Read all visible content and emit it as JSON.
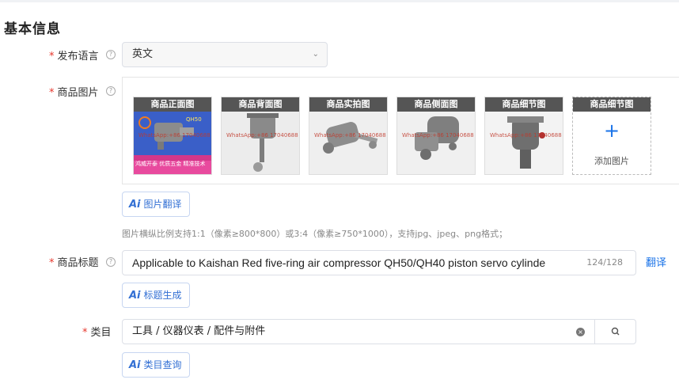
{
  "section": {
    "title": "基本信息"
  },
  "language": {
    "label": "发布语言",
    "value": "英文"
  },
  "images": {
    "label": "商品图片",
    "thumbs": [
      {
        "label": "商品正面图",
        "watermark": "WhatsApp:+86 17040688"
      },
      {
        "label": "商品背面图",
        "watermark": "WhatsApp:+86 17040688"
      },
      {
        "label": "商品实拍图",
        "watermark": "WhatsApp:+86 17040688"
      },
      {
        "label": "商品侧面图",
        "watermark": "WhatsApp:+86 17040688"
      },
      {
        "label": "商品细节图",
        "watermark": "WhatsApp:+86 17040688"
      }
    ],
    "add_slot": {
      "label": "商品细节图",
      "plus": "+",
      "text": "添加图片"
    },
    "front_overlay": {
      "code": "QH50",
      "caption": "鸿威开泰 优质五金 精准技术"
    },
    "translate_button": "图片翻译",
    "hint": "图片横纵比例支持1:1（像素≥800*800）或3:4（像素≥750*1000），支持jpg、jpeg、png格式；"
  },
  "title": {
    "label": "商品标题",
    "value": "Applicable to Kaishan Red five-ring air compressor QH50/QH40 piston servo cylinde",
    "count": "124/128",
    "translate_link": "翻译",
    "generate_button": "标题生成"
  },
  "category": {
    "label": "类目",
    "value": "工具 / 仪器仪表 / 配件与附件",
    "query_button": "类目查询"
  },
  "ai_mark": "Ai",
  "colors": {
    "accent": "#1a73e8",
    "required": "#e6352b"
  }
}
